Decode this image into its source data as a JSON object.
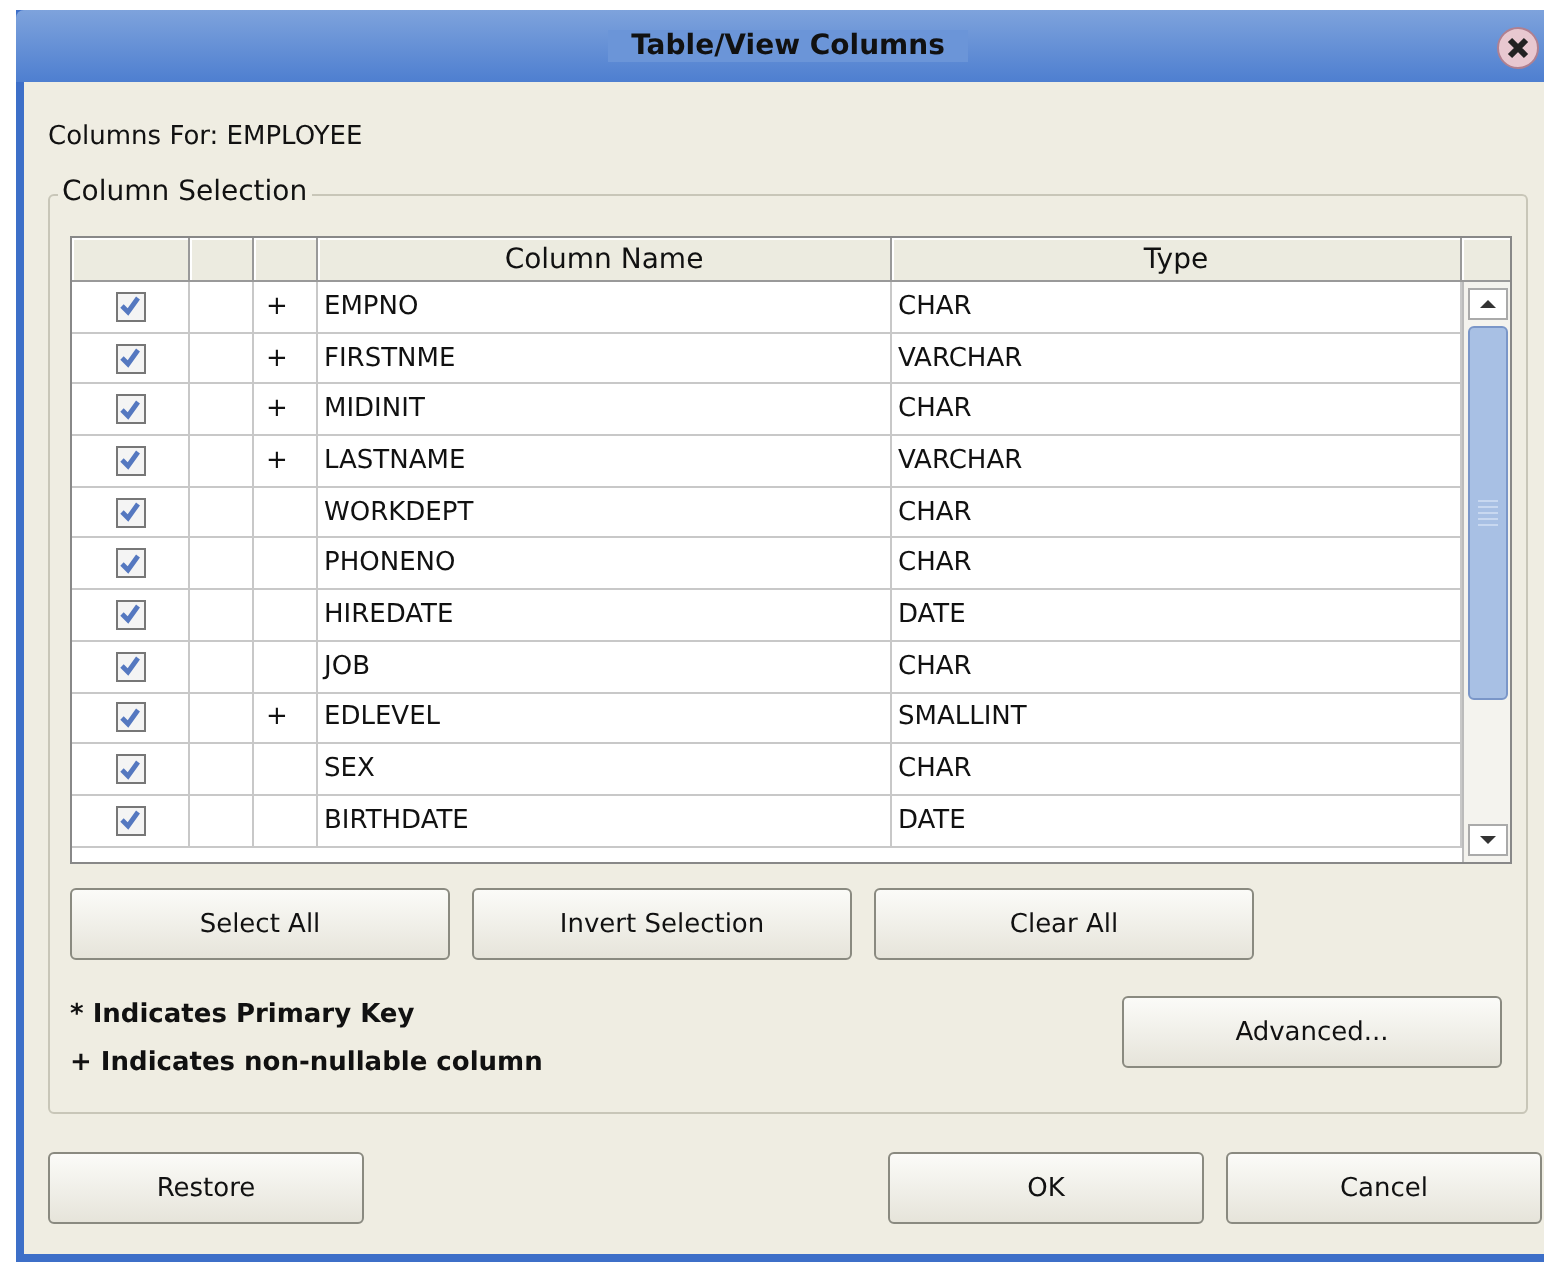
{
  "window": {
    "title": "Table/View Columns"
  },
  "columns_for": "Columns For: EMPLOYEE",
  "group_title": "Column Selection",
  "table": {
    "columns": [
      "",
      "",
      "",
      "Column Name",
      "Type"
    ],
    "rows": [
      {
        "checked": true,
        "marker": "+",
        "name": "EMPNO",
        "type": "CHAR"
      },
      {
        "checked": true,
        "marker": "+",
        "name": "FIRSTNME",
        "type": "VARCHAR"
      },
      {
        "checked": true,
        "marker": "+",
        "name": "MIDINIT",
        "type": "CHAR"
      },
      {
        "checked": true,
        "marker": "+",
        "name": "LASTNAME",
        "type": "VARCHAR"
      },
      {
        "checked": true,
        "name": "WORKDEPT",
        "type": "CHAR"
      },
      {
        "checked": true,
        "name": "PHONENO",
        "type": "CHAR"
      },
      {
        "checked": true,
        "name": "HIREDATE",
        "type": "DATE"
      },
      {
        "checked": true,
        "name": "JOB",
        "type": "CHAR"
      },
      {
        "checked": true,
        "marker": "+",
        "name": "EDLEVEL",
        "type": "SMALLINT"
      },
      {
        "checked": true,
        "name": "SEX",
        "type": "CHAR"
      },
      {
        "checked": true,
        "name": "BIRTHDATE",
        "type": "DATE"
      }
    ]
  },
  "selection_buttons": [
    {
      "label": "Select All"
    },
    {
      "label": "Invert Selection"
    },
    {
      "label": "Clear All"
    }
  ],
  "legend": [
    "* Indicates Primary Key",
    "+ Indicates non-nullable column"
  ],
  "advanced_button": {
    "label": "Advanced..."
  },
  "restore_button": {
    "label": "Restore"
  },
  "dialog_buttons": [
    {
      "label": "OK"
    },
    {
      "label": "Cancel"
    }
  ]
}
